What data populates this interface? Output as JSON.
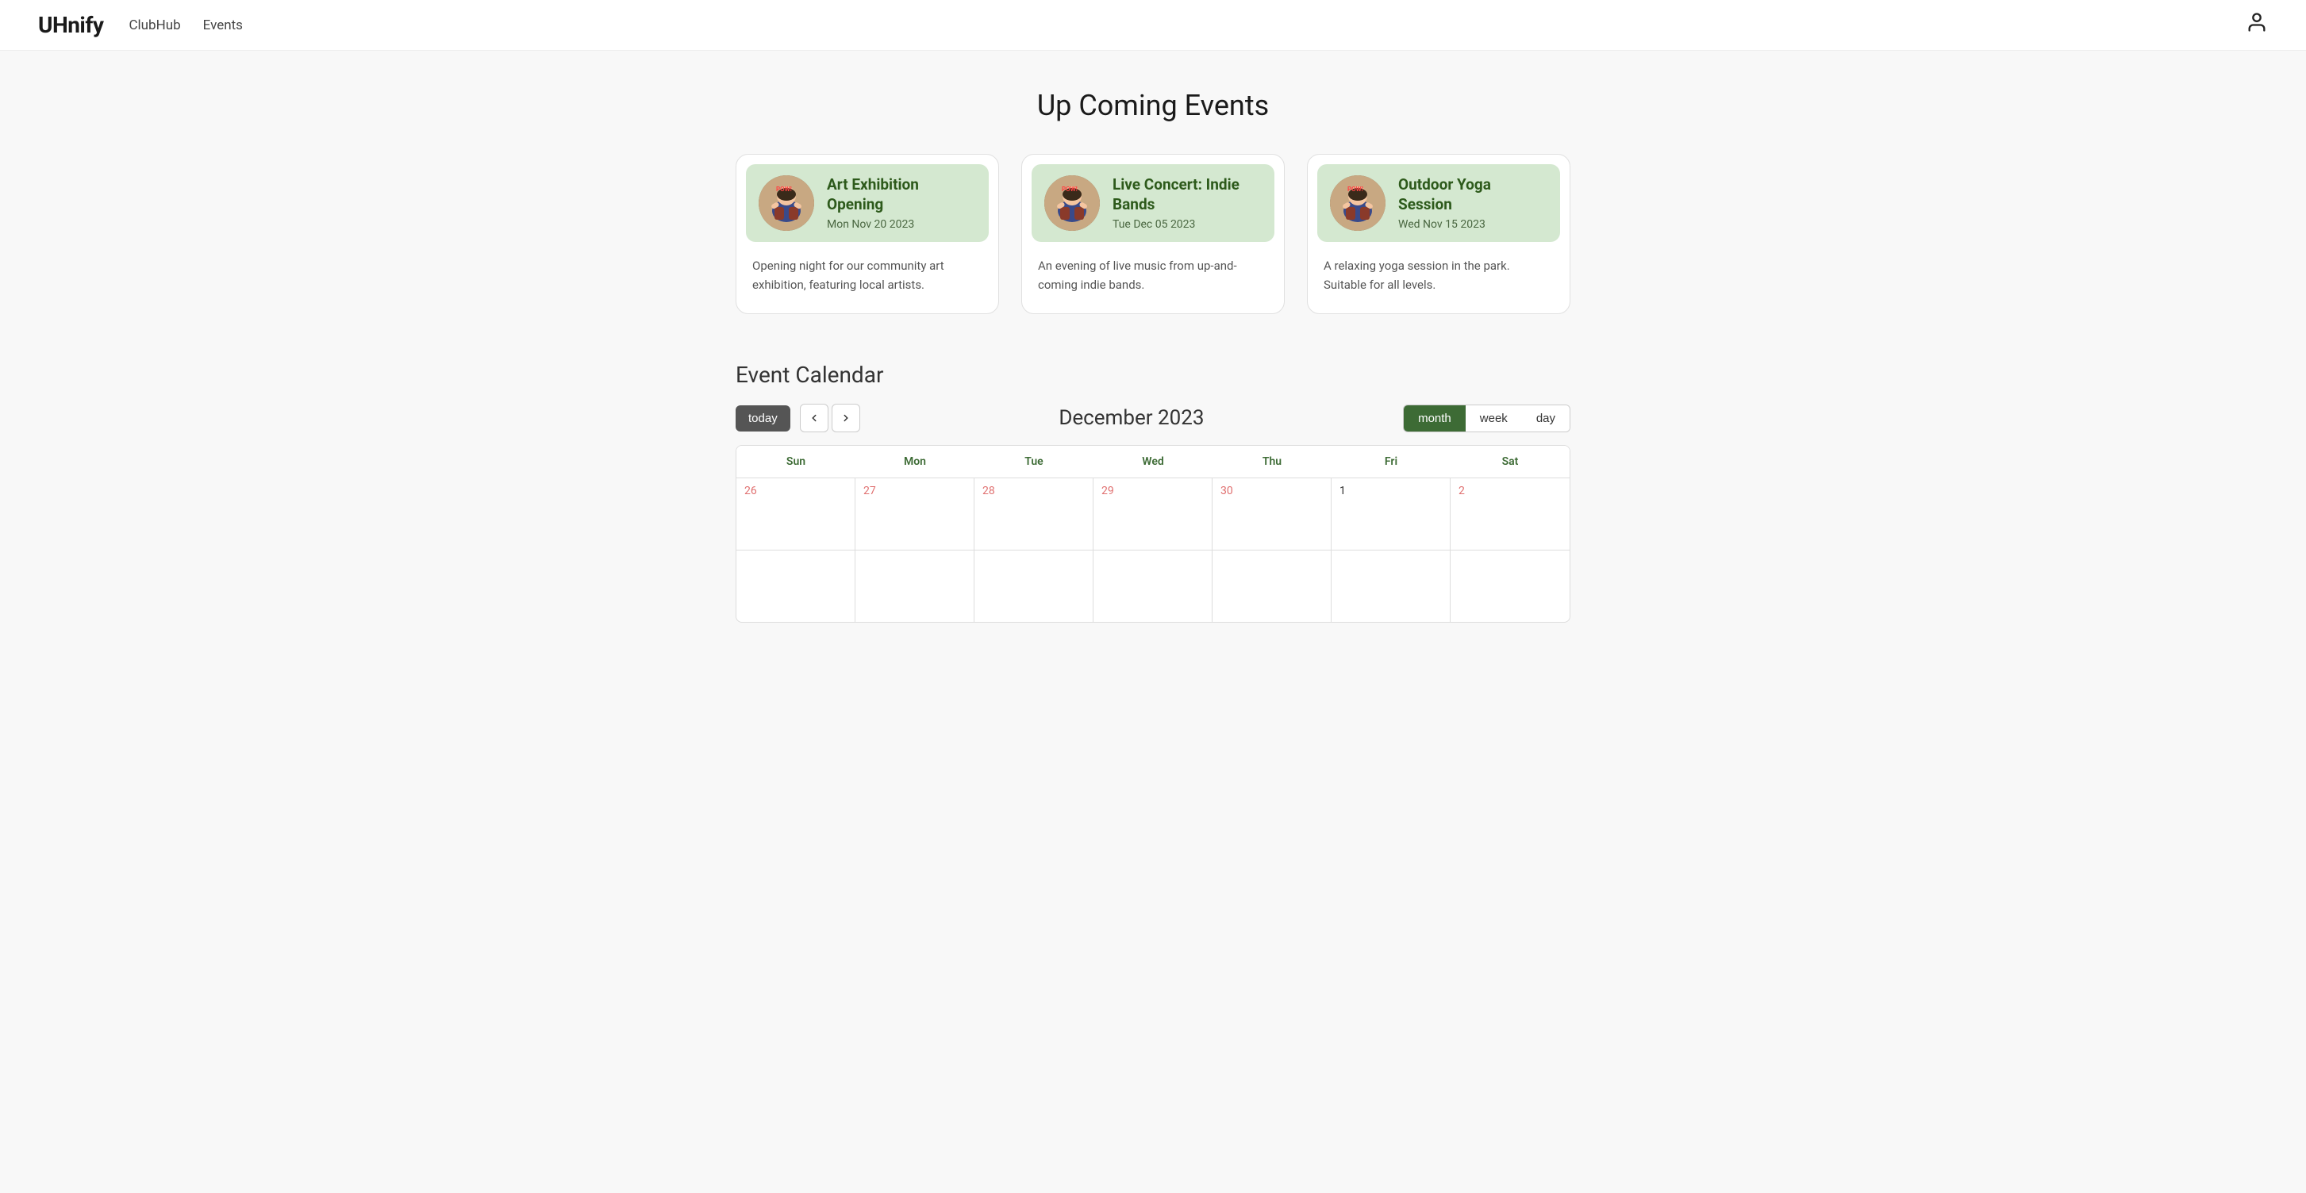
{
  "nav": {
    "brand": "UHnify",
    "links": [
      "ClubHub",
      "Events"
    ],
    "user_icon": "👤"
  },
  "page": {
    "title": "Up Coming Events"
  },
  "events": [
    {
      "id": "art-exhibition",
      "title": "Art Exhibition Opening",
      "date": "Mon Nov 20 2023",
      "description": "Opening night for our community art exhibition, featuring local artists."
    },
    {
      "id": "live-concert",
      "title": "Live Concert: Indie Bands",
      "date": "Tue Dec 05 2023",
      "description": "An evening of live music from up-and-coming indie bands."
    },
    {
      "id": "outdoor-yoga",
      "title": "Outdoor Yoga Session",
      "date": "Wed Nov 15 2023",
      "description": "A relaxing yoga session in the park. Suitable for all levels."
    }
  ],
  "calendar": {
    "section_title": "Event Calendar",
    "today_label": "today",
    "month_title": "December 2023",
    "view_options": [
      "month",
      "week",
      "day"
    ],
    "active_view": "month",
    "day_headers": [
      "Sun",
      "Mon",
      "Tue",
      "Wed",
      "Thu",
      "Fri",
      "Sat"
    ],
    "rows": [
      {
        "days": [
          {
            "num": "26",
            "type": "other",
            "events": []
          },
          {
            "num": "27",
            "type": "other",
            "events": []
          },
          {
            "num": "28",
            "type": "other",
            "events": []
          },
          {
            "num": "29",
            "type": "other",
            "events": []
          },
          {
            "num": "30",
            "type": "other",
            "events": []
          },
          {
            "num": "1",
            "type": "current",
            "events": []
          },
          {
            "num": "2",
            "type": "current-sat",
            "events": []
          }
        ]
      }
    ],
    "partial_row": {
      "days": [
        {
          "num": "",
          "type": "other"
        },
        {
          "num": "",
          "type": "other"
        },
        {
          "num": "",
          "type": "other"
        },
        {
          "num": "",
          "type": "other"
        },
        {
          "num": "",
          "type": "other"
        },
        {
          "num": "",
          "type": "other"
        },
        {
          "num": "",
          "type": "other"
        }
      ]
    }
  }
}
